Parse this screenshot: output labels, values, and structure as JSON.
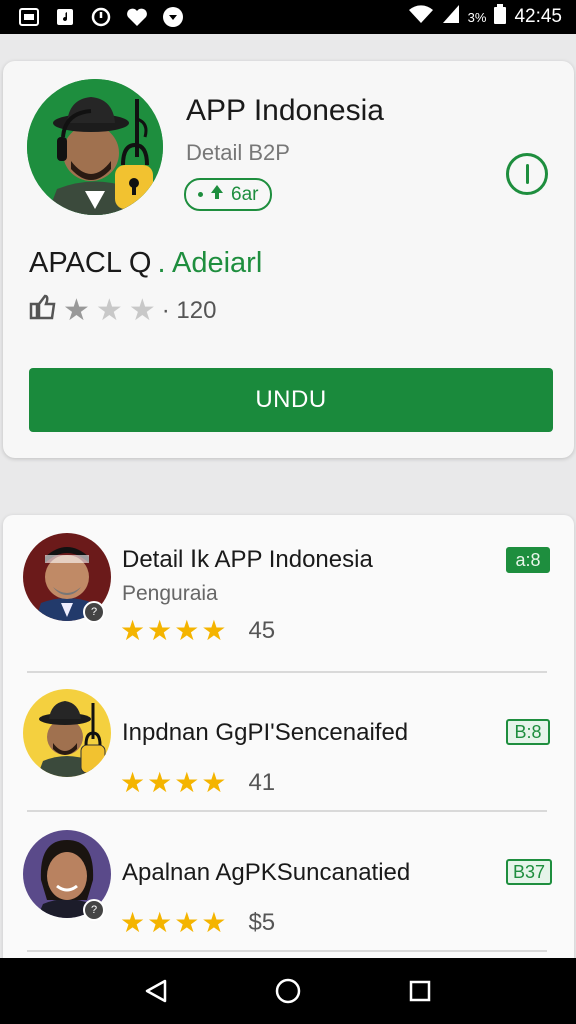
{
  "status_bar": {
    "time": "42:45",
    "battery_text": "3%",
    "icons": [
      "gallery-icon",
      "music-icon",
      "alarm-icon",
      "heart-icon",
      "location-icon",
      "wifi-icon",
      "signal-icon",
      "battery-icon"
    ]
  },
  "hero": {
    "title": "APP Indonesia",
    "subtitle": "Detail B2P",
    "chip_label": "6ar",
    "name_main": "APACL Q",
    "name_accent": ". Adeiarl",
    "rating_prefix_icon": "thumbs-icon",
    "rating_stars_filled": 1,
    "rating_stars_total": 3,
    "rating_count": "· 120",
    "install_label": "UNDU"
  },
  "list": {
    "items": [
      {
        "title": "Detail Ⅰk APP Indonesia",
        "subtitle": "Penguraia",
        "rating": "45",
        "stars": 4,
        "tag": "a:8"
      },
      {
        "title": "Inpdnan GgPI'Sencenaifed",
        "subtitle": "",
        "rating": "41",
        "stars": 4,
        "tag": "B:8"
      },
      {
        "title": "Apalnan AgPKSuncanatied",
        "subtitle": "",
        "rating": "$5",
        "stars": 4,
        "tag": "B37"
      }
    ]
  },
  "colors": {
    "accent": "#1e8e3e",
    "star": "#f4b400",
    "background": "#e9e9ea"
  },
  "nav": {
    "icons": [
      "back-icon",
      "home-icon",
      "recents-icon"
    ]
  }
}
